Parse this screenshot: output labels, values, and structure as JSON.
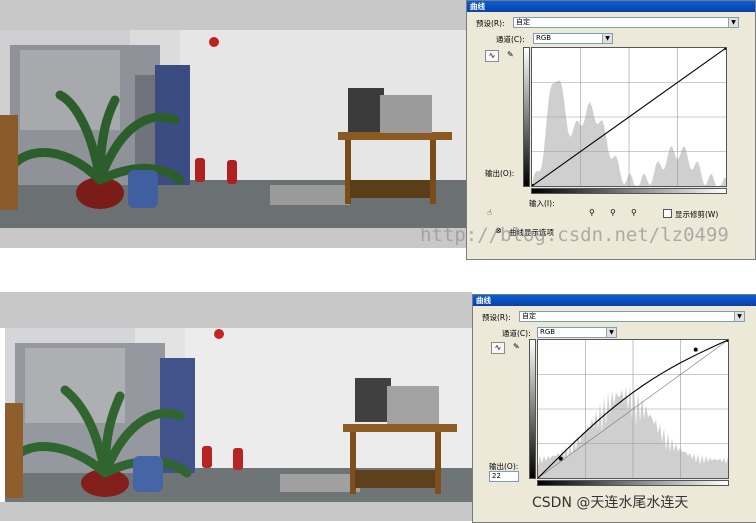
{
  "top": {
    "dialog": {
      "title": "曲线",
      "preset_label": "预设(R):",
      "preset_value": "自定",
      "channel_label": "通道(C):",
      "channel_value": "RGB",
      "output_label": "输出(O):",
      "input_label": "输入(I):",
      "show_clipping_label": "显示修剪(W)",
      "curve_options_label": "曲线显示选项"
    },
    "watermark": "http://blog.csdn.net/lz0499"
  },
  "bottom": {
    "dialog": {
      "title": "曲线",
      "preset_label": "预设(R):",
      "preset_value": "自定",
      "channel_label": "通道(C):",
      "channel_value": "RGB",
      "output_label": "输出(O):",
      "output_value": "22"
    },
    "watermark": "CSDN @天连水尾水连天"
  },
  "colors": {
    "title_bar": "#0b4fc0",
    "dialog_bg": "#ece9d8",
    "histogram": "#cfcfcf"
  }
}
